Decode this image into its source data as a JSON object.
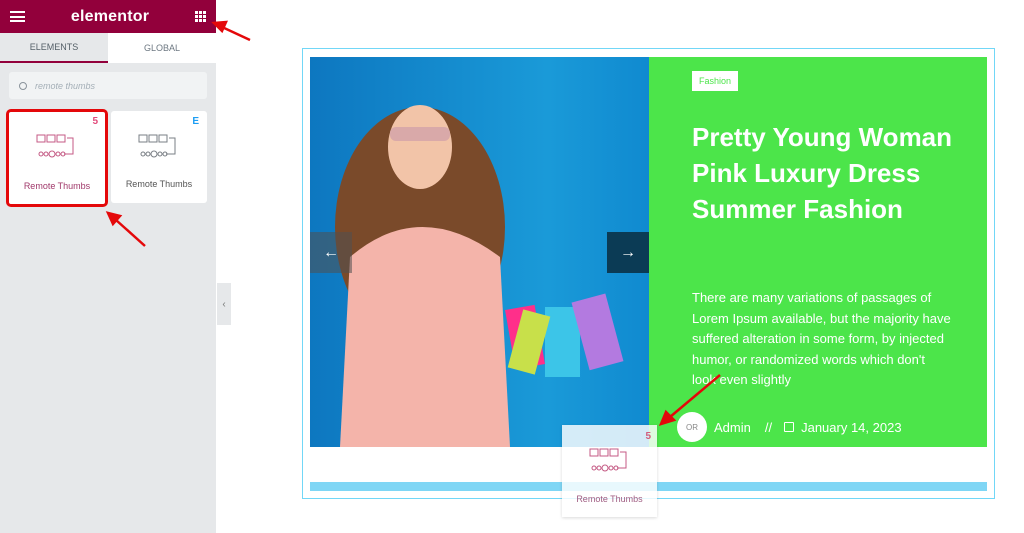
{
  "sidebar": {
    "logo": "elementor",
    "tabs": [
      {
        "label": "ELEMENTS",
        "active": true
      },
      {
        "label": "GLOBAL",
        "active": false
      }
    ],
    "search": {
      "placeholder": "remote thumbs"
    },
    "widgets": [
      {
        "label": "Remote Thumbs",
        "badge": "5",
        "badge_color": "#e2497a",
        "highlighted": true
      },
      {
        "label": "Remote Thumbs",
        "badge": "E",
        "badge_color": "#1e9ef3",
        "highlighted": false
      }
    ],
    "collapse_icon": "‹"
  },
  "canvas": {
    "slide": {
      "category": "Fashion",
      "title": "Pretty Young Woman Pink Luxury Dress Summer Fashion",
      "description": "There are many variations of passages of Lorem Ipsum available, but the majority have suffered alteration in some form, by injected humor, or randomized words which don't look even slightly",
      "author_initials": "OR",
      "author": "Admin",
      "separator": "//",
      "date": "January 14, 2023",
      "prev_icon": "←",
      "next_icon": "→"
    },
    "drag_ghost": {
      "label": "Remote Thumbs",
      "badge": "5"
    }
  },
  "colors": {
    "brand": "#92003b",
    "slide_bg": "#4ce54a",
    "highlight": "#e4080a",
    "accent_blue": "#7fd6f5"
  }
}
